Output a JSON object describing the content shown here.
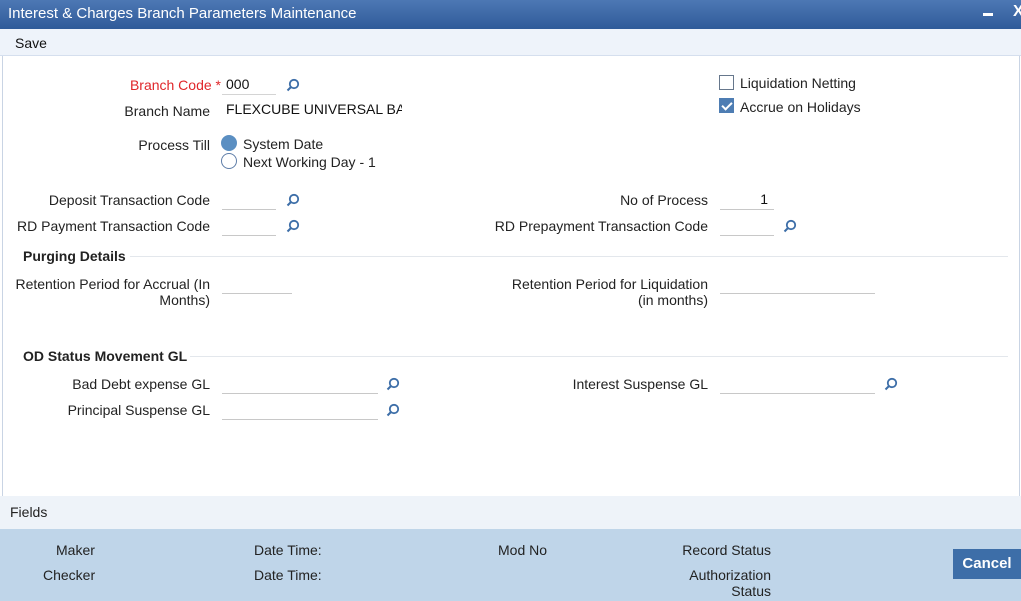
{
  "window": {
    "title": "Interest & Charges Branch Parameters Maintenance",
    "minimize": "minimize",
    "close": "X"
  },
  "toolbar": {
    "save_label": "Save"
  },
  "form": {
    "branch_code": {
      "label": "Branch Code",
      "required_mark": "*",
      "value": "000"
    },
    "branch_name": {
      "label": "Branch Name",
      "value": "FLEXCUBE UNIVERSAL BAN"
    },
    "process_till": {
      "label": "Process Till",
      "options": [
        "System Date",
        "Next Working Day - 1"
      ],
      "selected": "System Date"
    },
    "liquidation_netting": {
      "label": "Liquidation Netting",
      "checked": false
    },
    "accrue_on_holidays": {
      "label": "Accrue on Holidays",
      "checked": true
    },
    "deposit_txn_code": {
      "label": "Deposit Transaction Code",
      "value": ""
    },
    "rd_payment_txn_code": {
      "label": "RD Payment Transaction Code",
      "value": ""
    },
    "no_of_process": {
      "label": "No of Process",
      "value": "1"
    },
    "rd_prepayment_txn_code": {
      "label": "RD Prepayment Transaction Code",
      "value": ""
    }
  },
  "purging": {
    "heading": "Purging Details",
    "retention_accrual": {
      "label_line1": "Retention Period for Accrual (In",
      "label_line2": "Months)",
      "value": ""
    },
    "retention_liquidation": {
      "label_line1": "Retention Period for Liquidation",
      "label_line2": "(in months)",
      "value": ""
    }
  },
  "od_status": {
    "heading": "OD Status Movement GL",
    "bad_debt_gl": {
      "label": "Bad Debt expense GL",
      "value": ""
    },
    "principal_suspense_gl": {
      "label": "Principal Suspense GL",
      "value": ""
    },
    "interest_suspense_gl": {
      "label": "Interest Suspense GL",
      "value": ""
    }
  },
  "fields_bar": {
    "label": "Fields"
  },
  "audit": {
    "maker": "Maker",
    "checker": "Checker",
    "date_time_1": "Date Time:",
    "date_time_2": "Date Time:",
    "mod_no": "Mod No",
    "record_status": "Record Status",
    "authorization_status_line1": "Authorization",
    "authorization_status_line2": "Status"
  },
  "buttons": {
    "cancel": "Cancel"
  },
  "colors": {
    "titlebar": "#3a66a4",
    "accent": "#3d6ea8",
    "audit_bg": "#bfd5e9",
    "required": "#e0262a"
  }
}
